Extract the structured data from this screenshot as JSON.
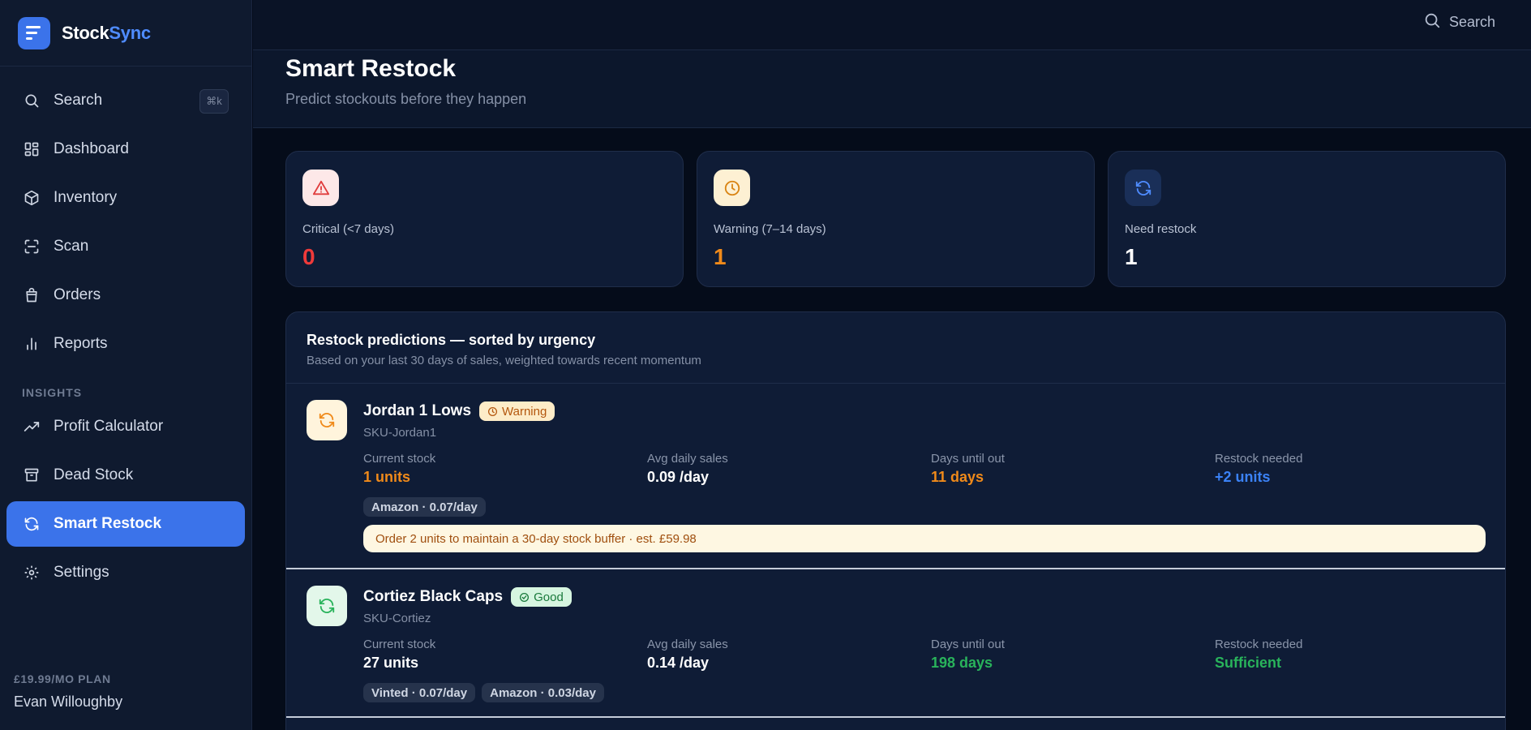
{
  "brand": {
    "name_part1": "Stock",
    "name_part2": "Sync"
  },
  "sidebar": {
    "search": {
      "label": "Search",
      "shortcut": "⌘k"
    },
    "items": [
      {
        "label": "Dashboard",
        "icon": "grid-icon"
      },
      {
        "label": "Inventory",
        "icon": "box-icon"
      },
      {
        "label": "Scan",
        "icon": "scan-icon"
      },
      {
        "label": "Orders",
        "icon": "bag-icon"
      },
      {
        "label": "Reports",
        "icon": "bar-chart-icon"
      }
    ],
    "section_label": "INSIGHTS",
    "insights": [
      {
        "label": "Profit Calculator",
        "icon": "trend-up-icon"
      },
      {
        "label": "Dead Stock",
        "icon": "archive-icon"
      },
      {
        "label": "Smart Restock",
        "icon": "refresh-icon",
        "active": true
      },
      {
        "label": "Settings",
        "icon": "gear-icon"
      }
    ],
    "plan_label": "£19.99/MO PLAN",
    "user_name": "Evan Willoughby"
  },
  "topbar": {
    "search_label": "Search"
  },
  "header": {
    "title": "Smart Restock",
    "subtitle": "Predict stockouts before they happen"
  },
  "stats": [
    {
      "label": "Critical (<7 days)",
      "value": "0",
      "icon": "alert-triangle-icon",
      "color": "#ef3a3a"
    },
    {
      "label": "Warning (7–14 days)",
      "value": "1",
      "icon": "clock-icon",
      "color": "#f08a1a"
    },
    {
      "label": "Need restock",
      "value": "1",
      "icon": "refresh-icon",
      "color": "#ffffff"
    }
  ],
  "predictions": {
    "title": "Restock predictions — sorted by urgency",
    "subtitle": "Based on your last 30 days of sales, weighted towards recent momentum",
    "metric_labels": {
      "current_stock": "Current stock",
      "avg_daily_sales": "Avg daily sales",
      "days_until_out": "Days until out",
      "restock_needed": "Restock needed"
    },
    "rows": [
      {
        "name": "Jordan 1 Lows",
        "status": "Warning",
        "sku": "SKU-Jordan1",
        "current_stock": "1 units",
        "avg_daily_sales": "0.09 /day",
        "days_until_out": "11 days",
        "restock_needed": "+2 units",
        "channels": [
          "Amazon · 0.07/day"
        ],
        "advice": "Order 2 units to maintain a 30-day stock buffer · est. £59.98"
      },
      {
        "name": "Cortiez Black Caps",
        "status": "Good",
        "sku": "SKU-Cortiez",
        "current_stock": "27 units",
        "avg_daily_sales": "0.14 /day",
        "days_until_out": "198 days",
        "restock_needed": "Sufficient",
        "channels": [
          "Vinted · 0.07/day",
          "Amazon · 0.03/day"
        ]
      }
    ]
  }
}
